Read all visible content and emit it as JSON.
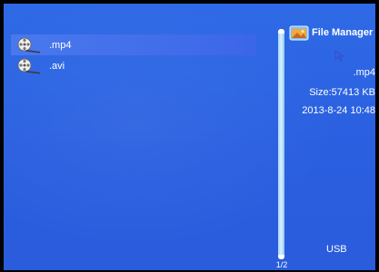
{
  "app": {
    "title": "File Manager",
    "icon": "folder-picture-icon"
  },
  "file_list": {
    "items": [
      {
        "name": ".mp4",
        "icon": "film-reel-icon",
        "selected": true
      },
      {
        "name": ".avi",
        "icon": "film-reel-icon",
        "selected": false
      }
    ]
  },
  "details": {
    "name": ".mp4",
    "size": "Size:57413 KB",
    "date": "2013-8-24 10:48"
  },
  "pagination": {
    "label": "1/2"
  },
  "source": {
    "label": "USB"
  },
  "colors": {
    "background": "#2f6ae6",
    "selection": "#5a80f0",
    "scroll_thumb": "#bfe4fb",
    "text": "#ffffff"
  }
}
